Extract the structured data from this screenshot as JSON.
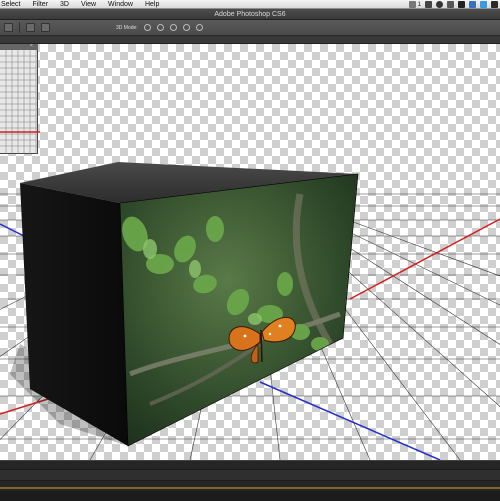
{
  "menubar": {
    "items": [
      "Select",
      "Filter",
      "3D",
      "View",
      "Window",
      "Help"
    ],
    "status_num": "1"
  },
  "window": {
    "title": "Adobe Photoshop CS6"
  },
  "options": {
    "mode_label": "3D Mode:"
  },
  "colors": {
    "red_axis": "#d42020",
    "blue_axis": "#2430c8",
    "accent": "#c89a2a"
  }
}
